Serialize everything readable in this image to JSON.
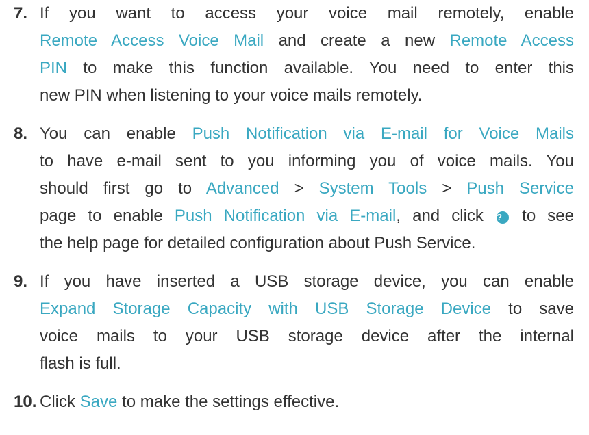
{
  "steps": [
    {
      "number": "7.",
      "lines": [
        [
          {
            "t": "If you want to access your voice mail remotely, enable"
          }
        ],
        [
          {
            "t": "Remote Access Voice Mail",
            "hl": true
          },
          {
            "t": " and create a new "
          },
          {
            "t": "Remote Access",
            "hl": true
          }
        ],
        [
          {
            "t": "PIN",
            "hl": true
          },
          {
            "t": " to make this function available. You need to enter this"
          }
        ],
        [
          {
            "t": "new PIN when listening to your voice mails remotely."
          }
        ]
      ]
    },
    {
      "number": "8.",
      "lines": [
        [
          {
            "t": "You can enable "
          },
          {
            "t": "Push Notification via E-mail for Voice Mails",
            "hl": true
          }
        ],
        [
          {
            "t": "to have e-mail sent to you informing you of voice mails. You"
          }
        ],
        [
          {
            "t": "should first go to "
          },
          {
            "t": "Advanced",
            "hl": true
          },
          {
            "t": " > "
          },
          {
            "t": "System Tools",
            "hl": true
          },
          {
            "t": " > "
          },
          {
            "t": "Push Service",
            "hl": true
          }
        ],
        [
          {
            "t": "page to enable "
          },
          {
            "t": "Push Notification via E-mail",
            "hl": true
          },
          {
            "t": ", and click "
          },
          {
            "icon": "help-icon",
            "glyph": "?"
          },
          {
            "t": " to see"
          }
        ],
        [
          {
            "t": "the help page for detailed configuration about Push Service."
          }
        ]
      ]
    },
    {
      "number": "9.",
      "lines": [
        [
          {
            "t": "If you have inserted a USB storage device, you can enable"
          }
        ],
        [
          {
            "t": "Expand Storage Capacity with USB Storage Device",
            "hl": true
          },
          {
            "t": " to save"
          }
        ],
        [
          {
            "t": "voice mails to your USB storage device after the internal"
          }
        ],
        [
          {
            "t": "flash is full."
          }
        ]
      ]
    },
    {
      "number": "10.",
      "lines": [
        [
          {
            "t": "Click "
          },
          {
            "t": "Save",
            "hl": true
          },
          {
            "t": " to make the settings effective."
          }
        ]
      ]
    }
  ],
  "colors": {
    "text": "#333333",
    "link": "#3aa8c1"
  }
}
